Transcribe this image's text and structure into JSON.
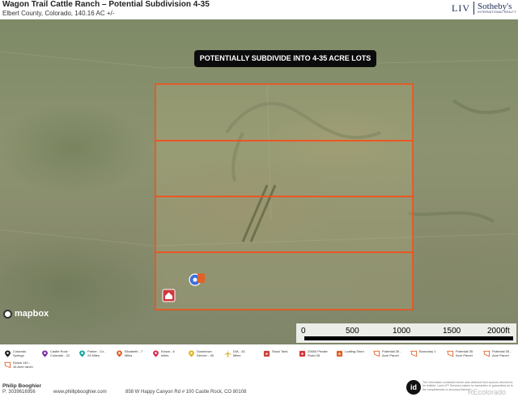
{
  "header": {
    "title": "Wagon Trail Cattle Ranch – Potential Subdivision 4-35",
    "subtitle": "Elbert County, Colorado, 140.16 AC +/-",
    "brand_liv": "LIV",
    "brand_name": "Sotheby's",
    "brand_sub": "INTERNATIONAL REALTY"
  },
  "map": {
    "callout": "POTENTIALLY SUBDIVIDE INTO 4-35 ACRE LOTS",
    "attribution": "mapbox",
    "lot_outline_color": "#f2511b",
    "scale": {
      "labels": [
        "0",
        "500",
        "1000",
        "1500",
        "2000ft"
      ]
    }
  },
  "legend": {
    "items": [
      {
        "label": "Colorado\nSprings",
        "icon": "colorado-springs-pin-icon",
        "color": "#1a1a1a"
      },
      {
        "label": "Castle Rock ·\nColorado - 22",
        "icon": "castle-rock-pin-icon",
        "color": "#7b2fa0"
      },
      {
        "label": "Parker , Co -\n24 Miles",
        "icon": "parker-pin-icon",
        "color": "#1aa6a0"
      },
      {
        "label": "Elizabeth - 7\nMiles",
        "icon": "elizabeth-pin-icon",
        "color": "#e0622a"
      },
      {
        "label": "Kiowa - 6\nmiles",
        "icon": "kiowa-pin-icon",
        "color": "#d62b4c"
      },
      {
        "label": "Downtown\nDenver - 45",
        "icon": "downtown-denver-pin-icon",
        "color": "#e0b21d"
      },
      {
        "label": "DIA - 43\nMiles",
        "icon": "airplane-icon",
        "color": "#e0b21d"
      },
      {
        "label": "Stock Tank",
        "icon": "stock-tank-icon",
        "color": "#c8453b"
      },
      {
        "label": "20650 Private\nRoad 35",
        "icon": "house-icon",
        "color": "#d1383b"
      },
      {
        "label": "Loafing Shed",
        "icon": "shed-icon",
        "color": "#e0622a"
      },
      {
        "label": "Potential 35 -\nAcre Parcel",
        "icon": "parcel-outline-icon",
        "color": "#e0622a"
      },
      {
        "label": "Boundary 1",
        "icon": "boundary-outline-icon",
        "color": "#e0622a"
      },
      {
        "label": "Potential 35\nAcre Parcel",
        "icon": "parcel-outline-icon",
        "color": "#e0622a"
      },
      {
        "label": "Potential 35 -\nAcre Parcel",
        "icon": "parcel-outline-icon",
        "color": "#e0622a"
      },
      {
        "label": "Kiowa 140 -\n16 Acre ranch",
        "icon": "ranch-outline-icon",
        "color": "#e0622a"
      }
    ]
  },
  "footer": {
    "agent_name": "Philip Booghier",
    "agent_phone": "P: 3039616956",
    "agent_web": "www.phillipbooghier.com",
    "agent_address": "858 W Happy Canyon Rd # 100 Castle Rock, CO 80108",
    "id_logo": "id",
    "disclaimer": "The information contained herein was obtained from sources deemed to be reliable. Land id™ Services makes no warranties or guarantees as to the completeness or accuracy thereof.",
    "recolorado": "REcolorado"
  }
}
